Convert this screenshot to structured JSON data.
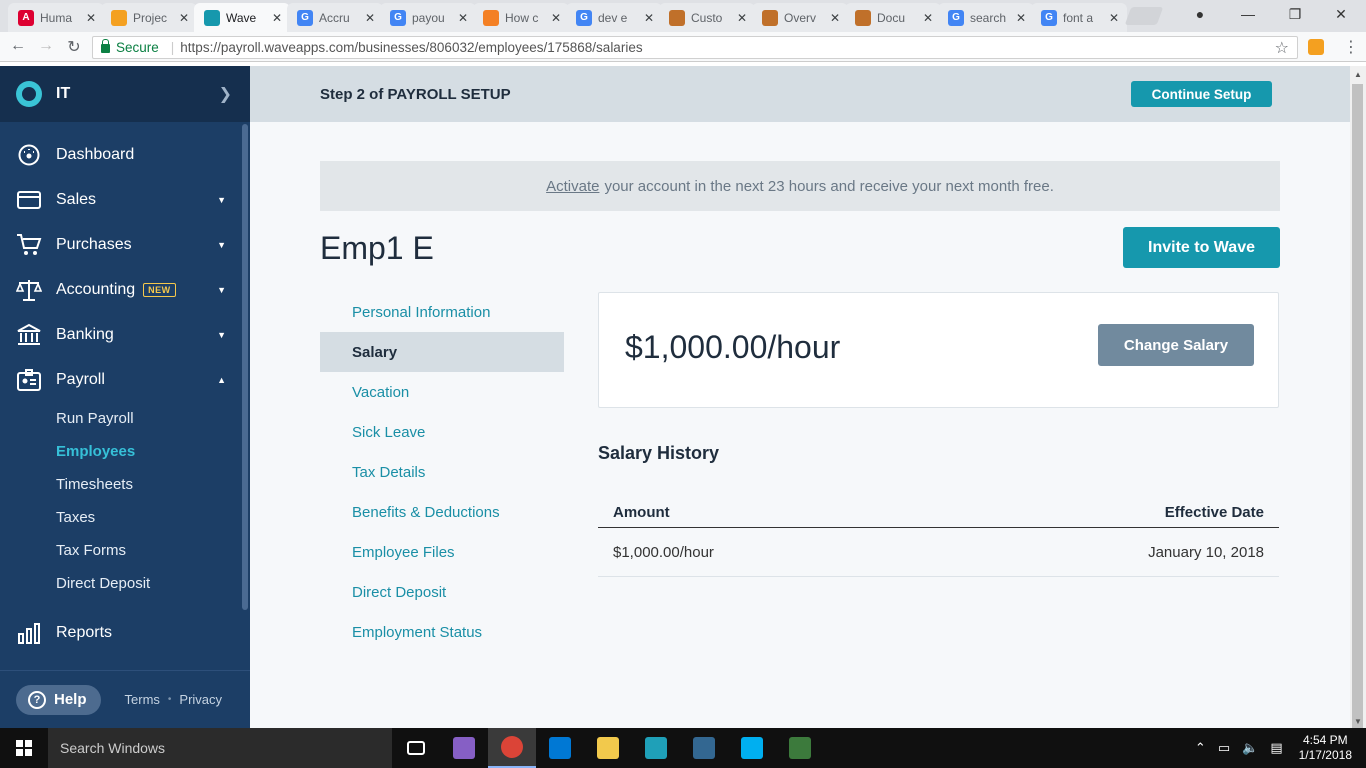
{
  "browser": {
    "tabs": [
      {
        "label": "Huma",
        "icon": "angular-icon",
        "color": "#dd0031",
        "glyph": "A"
      },
      {
        "label": "Projec",
        "icon": "project-icon",
        "color": "#f4a020",
        "glyph": ""
      },
      {
        "label": "Wave",
        "icon": "wave-icon",
        "color": "#1698ad",
        "glyph": ""
      },
      {
        "label": "Accru",
        "icon": "google-icon",
        "color": "#4285f4",
        "glyph": "G"
      },
      {
        "label": "payou",
        "icon": "google-icon",
        "color": "#4285f4",
        "glyph": "G"
      },
      {
        "label": "How c",
        "icon": "stackoverflow-icon",
        "color": "#f48024",
        "glyph": ""
      },
      {
        "label": "dev e",
        "icon": "google-icon",
        "color": "#4285f4",
        "glyph": "G"
      },
      {
        "label": "Custo",
        "icon": "docs-icon",
        "color": "#c0702a",
        "glyph": ""
      },
      {
        "label": "Overv",
        "icon": "docs-icon",
        "color": "#c0702a",
        "glyph": ""
      },
      {
        "label": "Docu",
        "icon": "docs-icon",
        "color": "#c0702a",
        "glyph": ""
      },
      {
        "label": "search",
        "icon": "google-icon",
        "color": "#4285f4",
        "glyph": "G"
      },
      {
        "label": "font a",
        "icon": "google-icon",
        "color": "#4285f4",
        "glyph": "G"
      }
    ],
    "active_tab": 2,
    "secure_label": "Secure",
    "url": "https://payroll.waveapps.com/businesses/806032/employees/175868/salaries"
  },
  "sidebar": {
    "business": "IT",
    "items": [
      {
        "label": "Dashboard",
        "icon": "dashboard-icon",
        "caret": ""
      },
      {
        "label": "Sales",
        "icon": "sales-icon",
        "caret": "down"
      },
      {
        "label": "Purchases",
        "icon": "cart-icon",
        "caret": "down"
      },
      {
        "label": "Accounting",
        "icon": "scale-icon",
        "caret": "down",
        "badge": "NEW"
      },
      {
        "label": "Banking",
        "icon": "bank-icon",
        "caret": "down"
      },
      {
        "label": "Payroll",
        "icon": "payroll-icon",
        "caret": "up"
      }
    ],
    "payroll_sub": [
      "Run Payroll",
      "Employees",
      "Timesheets",
      "Taxes",
      "Tax Forms",
      "Direct Deposit"
    ],
    "active_sub": 1,
    "reports": "Reports",
    "help": "Help",
    "terms": "Terms",
    "privacy": "Privacy"
  },
  "header": {
    "setup_title": "Step 2 of PAYROLL SETUP",
    "continue_label": "Continue Setup"
  },
  "promo": {
    "link": "Activate",
    "text": "your account in the next 23 hours and receive your next month free."
  },
  "employee": {
    "name": "Emp1 E",
    "invite_label": "Invite to Wave"
  },
  "subnav": {
    "items": [
      "Personal Information",
      "Salary",
      "Vacation",
      "Sick Leave",
      "Tax Details",
      "Benefits & Deductions",
      "Employee Files",
      "Direct Deposit",
      "Employment Status"
    ],
    "active": 1
  },
  "salary": {
    "amount": "$1,000.00/hour",
    "change_label": "Change Salary"
  },
  "history": {
    "title": "Salary History",
    "col_amount": "Amount",
    "col_date": "Effective Date",
    "rows": [
      {
        "amount": "$1,000.00/hour",
        "date": "January 10, 2018"
      }
    ]
  },
  "taskbar": {
    "search_placeholder": "Search Windows",
    "time": "4:54 PM",
    "date": "1/17/2018",
    "apps": [
      {
        "name": "task-view-icon",
        "color": "#101010",
        "active": false
      },
      {
        "name": "visual-studio-icon",
        "color": "#865fc5",
        "active": false
      },
      {
        "name": "chrome-icon",
        "color": "#db4437",
        "active": true
      },
      {
        "name": "vscode-icon",
        "color": "#0078d4",
        "active": false
      },
      {
        "name": "file-explorer-icon",
        "color": "#f2c94c",
        "active": false
      },
      {
        "name": "network-app-icon",
        "color": "#1fa0b8",
        "active": false
      },
      {
        "name": "postgres-icon",
        "color": "#336791",
        "active": false
      },
      {
        "name": "skype-icon",
        "color": "#00aff0",
        "active": false
      },
      {
        "name": "terminal-app-icon",
        "color": "#3c7a3c",
        "active": false
      }
    ]
  }
}
